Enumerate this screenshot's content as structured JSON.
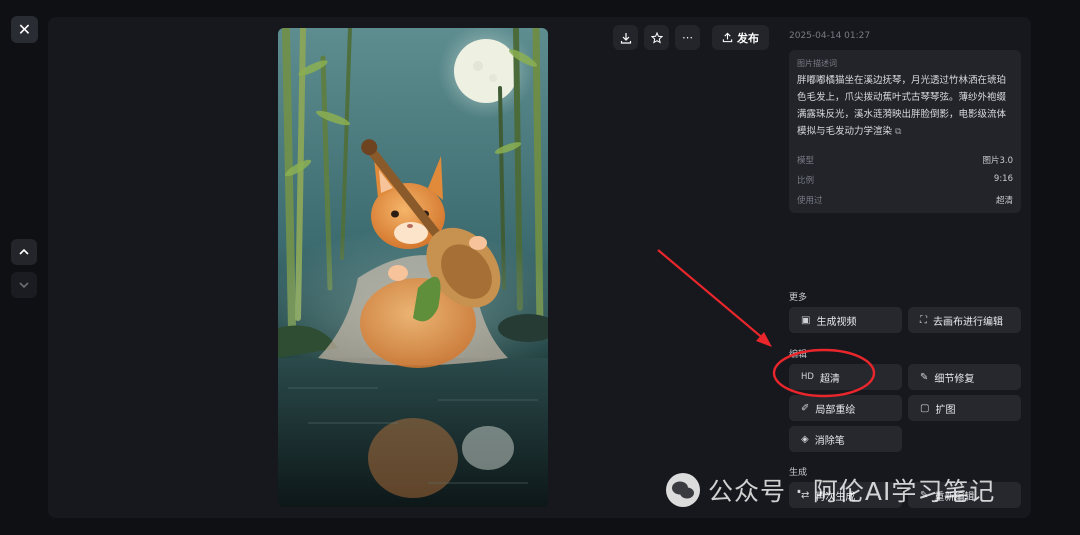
{
  "toolbar": {
    "publish_label": "发布"
  },
  "info": {
    "timestamp": "2025-04-14 01:27",
    "desc_label": "图片描述词",
    "description": "胖嘟嘟橘猫坐在溪边抚琴，月光透过竹林洒在琥珀色毛发上，爪尖拨动蕉叶式古琴琴弦。薄纱外袍缀满露珠反光，溪水涟漪映出胖脸倒影，电影级流体模拟与毛发动力学渲染",
    "meta": [
      {
        "key": "模型",
        "value": "图片3.0"
      },
      {
        "key": "比例",
        "value": "9:16"
      },
      {
        "key": "使用过",
        "value": "超清"
      }
    ]
  },
  "sections": {
    "more_label": "更多",
    "edit_label": "编辑",
    "generate_label": "生成"
  },
  "actions": {
    "gen_video": "生成视频",
    "canvas_edit": "去画布进行编辑",
    "upscale_prefix": "HD",
    "upscale": "超清",
    "detail_fix": "细节修复",
    "inpaint": "局部重绘",
    "outpaint": "扩图",
    "eraser": "消除笔",
    "regenerate": "再次生成",
    "reedit": "重新编辑"
  },
  "watermark": {
    "text": "公众号 · 阿伦AI学习笔记"
  },
  "colors": {
    "annotation_red": "#e8262b",
    "panel_bg": "#17181d",
    "button_bg": "#26282e"
  }
}
